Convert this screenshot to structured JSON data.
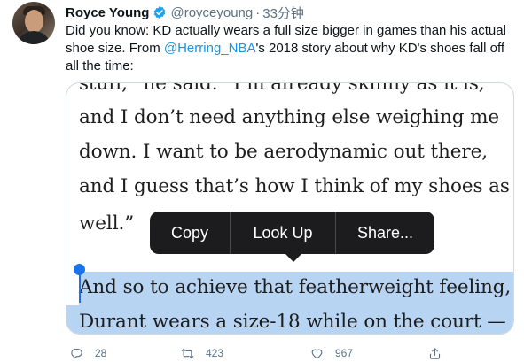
{
  "tweet": {
    "author": {
      "display_name": "Royce Young",
      "handle": "@royceyoung",
      "verified": true
    },
    "separator": "·",
    "timestamp": "33分钟",
    "text_before_mention": "Did you know: KD actually wears a full size bigger in games than his actual shoe size. From ",
    "mention": "@Herring_NBA",
    "text_after_mention": "'s 2018 story about why KD's shoes fall off all the time:",
    "mention_color": "#1b95e0"
  },
  "media": {
    "book_lines": [
      "stuff,” he said. “I’m already skinny as it is,",
      "and I don’t need anything else weighing me",
      "down. I want to be aerodynamic out there,",
      "and I guess that’s how I think of my shoes as",
      "well.”",
      "And so to achieve that featherweight feeling,",
      "Durant wears a size-18 while on the court —"
    ],
    "context_menu": {
      "copy": "Copy",
      "look_up": "Look Up",
      "share": "Share..."
    },
    "selection_color": "#b8d4f3",
    "caret_color": "#1a73e8"
  },
  "actions": {
    "reply": {
      "icon": "reply-icon",
      "count": "28"
    },
    "retweet": {
      "icon": "retweet-icon",
      "count": "423"
    },
    "like": {
      "icon": "heart-icon",
      "count": "967"
    },
    "share": {
      "icon": "share-icon"
    }
  }
}
